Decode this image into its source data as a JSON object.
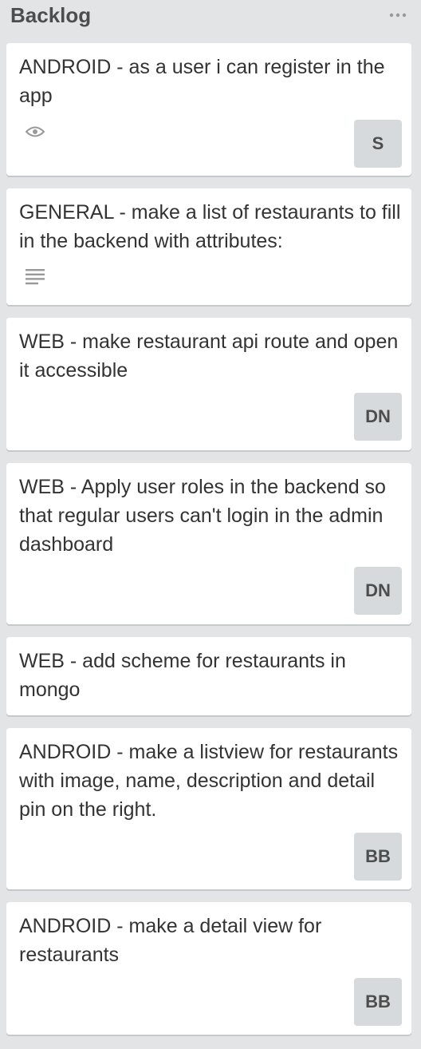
{
  "list": {
    "title": "Backlog",
    "menu_icon": "more-horizontal-icon"
  },
  "cards": [
    {
      "title": "ANDROID - as a user i can register in the app",
      "badge_icon": "eye-icon",
      "member": "S"
    },
    {
      "title": "GENERAL - make a list of restaurants to fill in the backend with attributes:",
      "badge_icon": "description-icon"
    },
    {
      "title": "WEB - make restaurant api route and open it accessible",
      "member": "DN"
    },
    {
      "title": "WEB - Apply user roles in the backend so that regular users can't login in the admin dashboard",
      "member": "DN"
    },
    {
      "title": "WEB - add scheme for restaurants in mongo"
    },
    {
      "title": "ANDROID - make a listview for restaurants with image, name, description and detail pin on the right.",
      "member": "BB"
    },
    {
      "title": "ANDROID - make a detail view for restaurants",
      "member": "BB"
    }
  ],
  "colors": {
    "list_bg": "#e2e4e6",
    "card_bg": "#ffffff",
    "text": "#333333",
    "avatar_bg": "#d6dadc",
    "icon": "#999999"
  }
}
